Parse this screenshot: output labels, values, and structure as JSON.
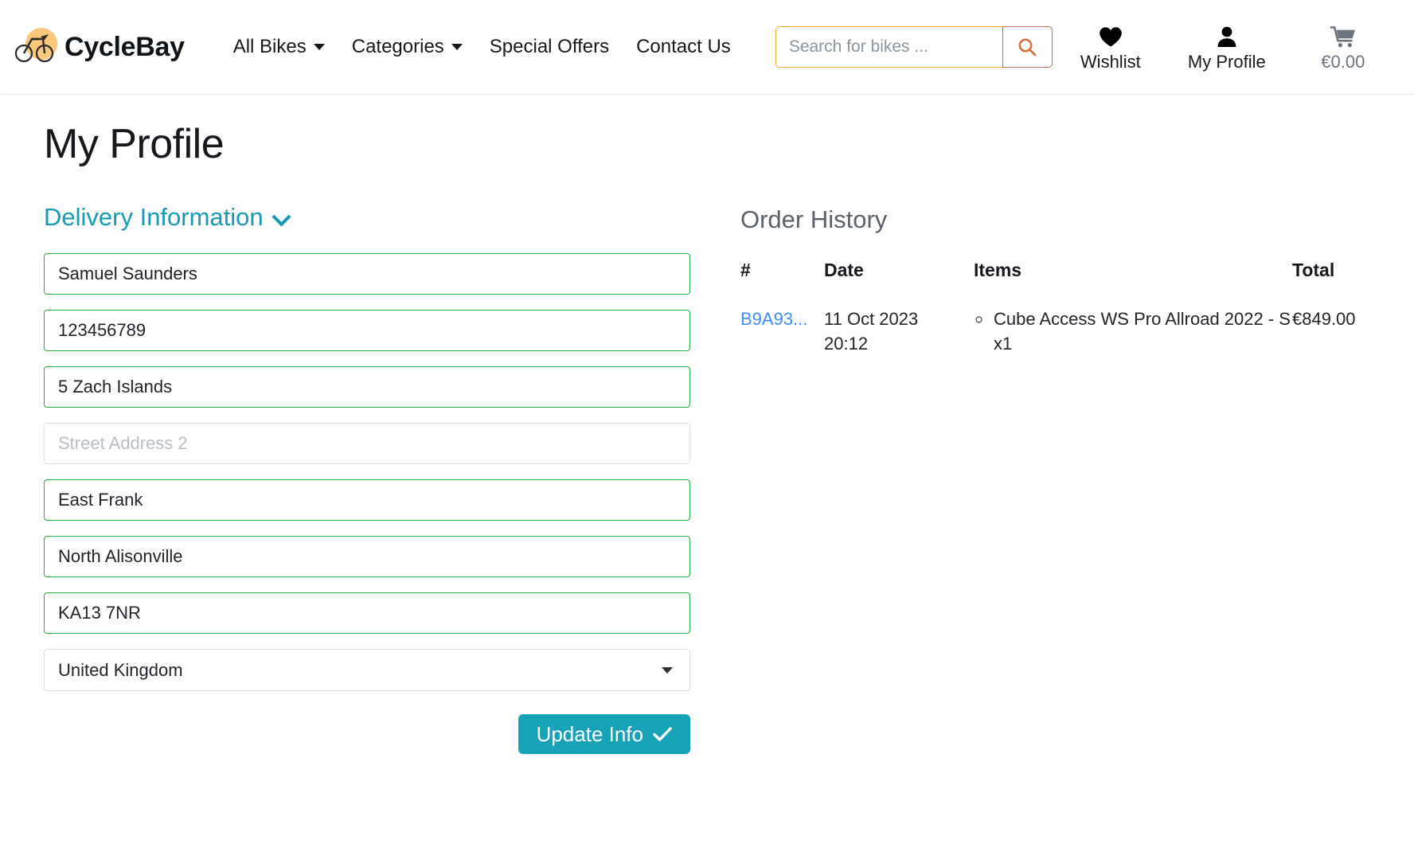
{
  "header": {
    "brand": {
      "name": "CycleBay",
      "icon": "bicycle-icon"
    },
    "nav": [
      {
        "label": "All Bikes",
        "has_caret": true
      },
      {
        "label": "Categories",
        "has_caret": true
      },
      {
        "label": "Special Offers",
        "has_caret": false
      },
      {
        "label": "Contact Us",
        "has_caret": false
      }
    ],
    "search": {
      "placeholder": "Search for bikes ...",
      "value": "",
      "button_icon": "search-icon"
    },
    "actions": [
      {
        "label": "Wishlist",
        "icon": "heart-icon",
        "muted": false
      },
      {
        "label": "My Profile",
        "icon": "user-icon",
        "muted": false
      },
      {
        "label": "€0.00",
        "icon": "cart-icon",
        "muted": true
      }
    ]
  },
  "page": {
    "title": "My Profile"
  },
  "delivery": {
    "section_label": "Delivery Information",
    "fields": [
      {
        "name": "full-name",
        "value": "Samuel Saunders",
        "placeholder": "",
        "state": "valid"
      },
      {
        "name": "phone-number",
        "value": "123456789",
        "placeholder": "",
        "state": "valid"
      },
      {
        "name": "street-address-1",
        "value": "5 Zach Islands",
        "placeholder": "",
        "state": "valid"
      },
      {
        "name": "street-address-2",
        "value": "",
        "placeholder": "Street Address 2",
        "state": "empty"
      },
      {
        "name": "town-city",
        "value": "East Frank",
        "placeholder": "",
        "state": "valid"
      },
      {
        "name": "county-state",
        "value": "North Alisonville",
        "placeholder": "",
        "state": "valid"
      },
      {
        "name": "postcode",
        "value": "KA13 7NR",
        "placeholder": "",
        "state": "valid"
      }
    ],
    "country": {
      "selected": "United Kingdom"
    },
    "submit_label": "Update Info"
  },
  "order_history": {
    "title": "Order History",
    "columns": [
      "#",
      "Date",
      "Items",
      "Total"
    ],
    "rows": [
      {
        "id": "B9A93...",
        "date_line1": "11 Oct 2023",
        "date_line2": "20:12",
        "items": [
          "Cube Access WS Pro Allroad 2022 - S x1"
        ],
        "total": "€849.00"
      }
    ]
  },
  "colors": {
    "brand_accent": "#fbc87d",
    "search_border": "#f0ad27",
    "search_icon": "#d2703f",
    "teal": "#17a2b8",
    "section_link": "#159cb3",
    "valid_border": "#28a745",
    "order_link": "#3d8bfd"
  }
}
